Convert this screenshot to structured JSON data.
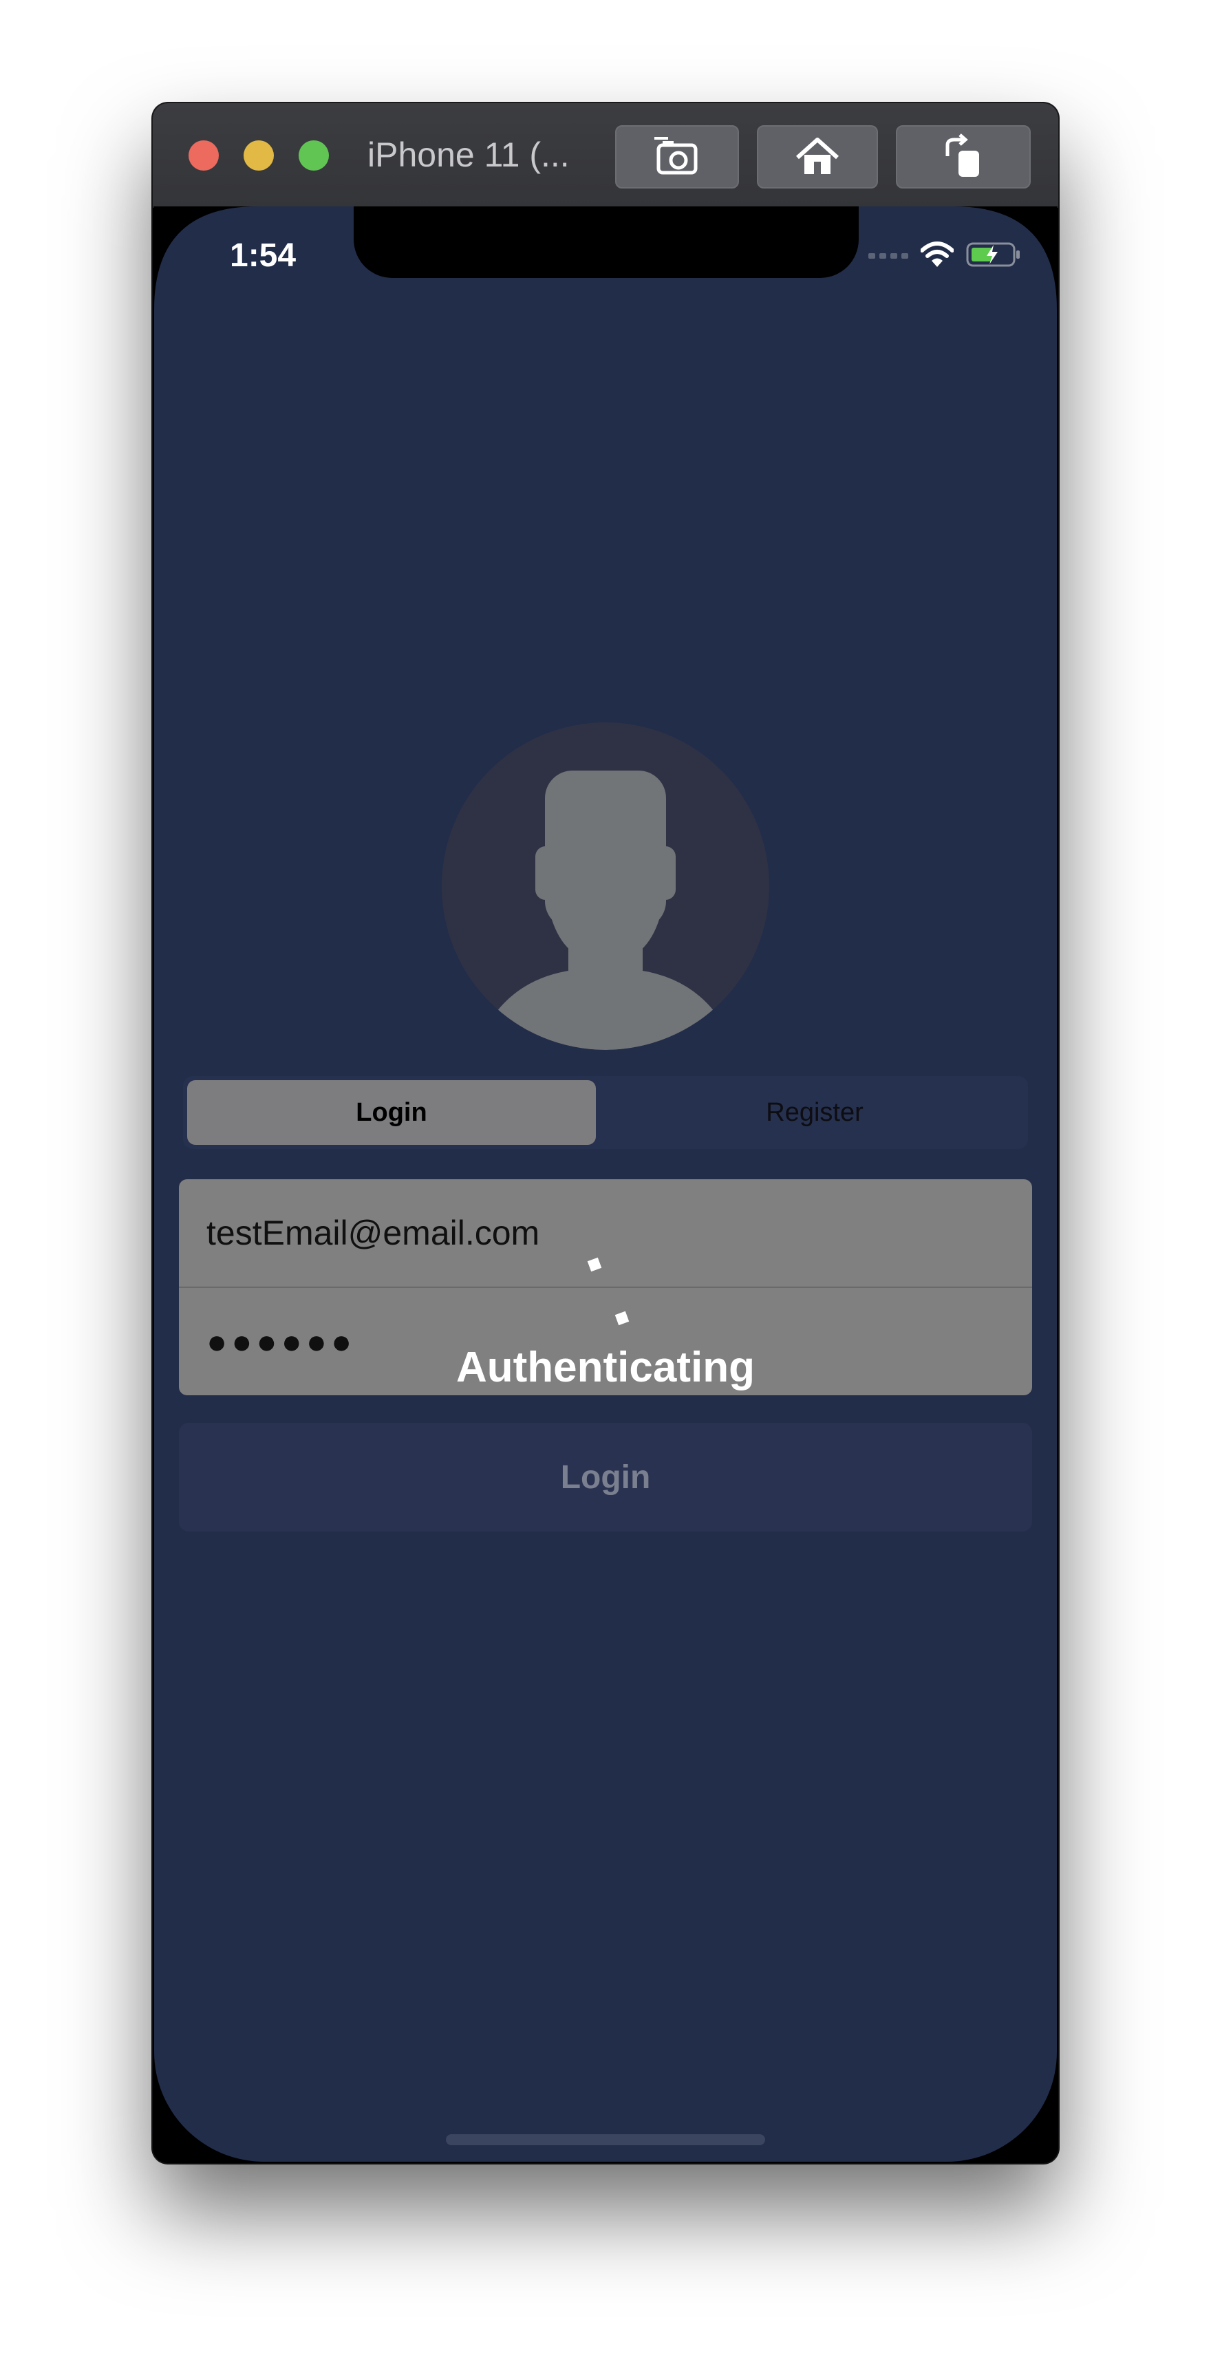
{
  "window": {
    "title": "iPhone 11 (...",
    "buttons": [
      "screenshot-icon",
      "home-icon",
      "rotate-icon"
    ]
  },
  "status_bar": {
    "time": "1:54",
    "icons": [
      "signal-icon",
      "wifi-icon",
      "battery-charging-icon"
    ]
  },
  "segment": {
    "items": [
      {
        "label": "Login",
        "selected": true
      },
      {
        "label": "Register",
        "selected": false
      }
    ]
  },
  "form": {
    "email_value": "testEmail@email.com",
    "password_value": "●●●●●●"
  },
  "overlay": {
    "label": "Authenticating"
  },
  "login_button": {
    "label": "Login"
  },
  "colors": {
    "background": "#222d4a",
    "field_bg": "#808080",
    "segment_selected": "#7d7d7f"
  }
}
